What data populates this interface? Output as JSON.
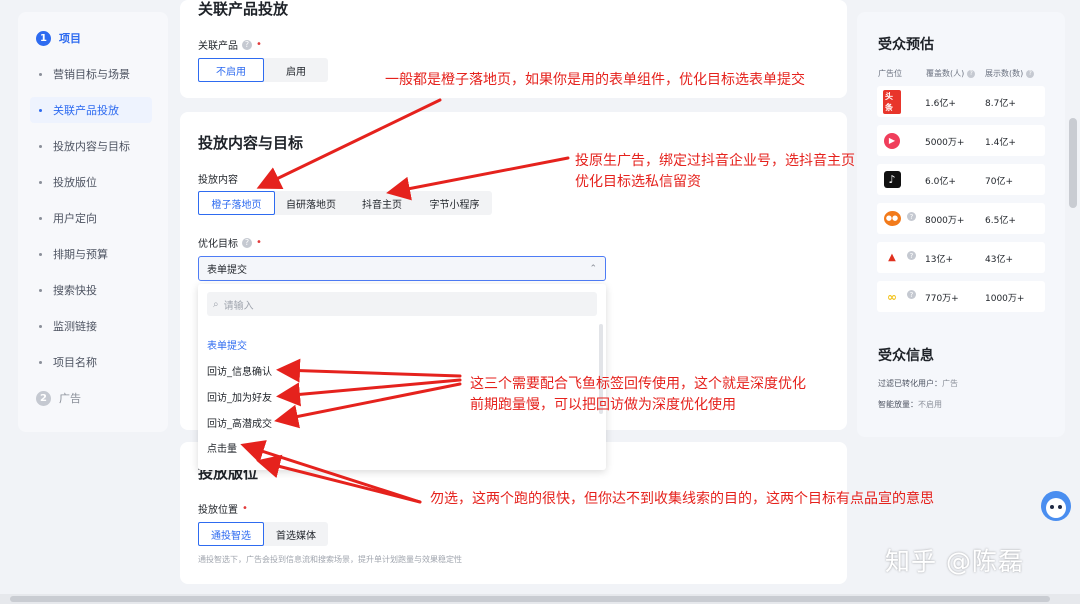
{
  "sidebar": {
    "section1": {
      "num": "1",
      "label": "项目"
    },
    "items": [
      {
        "label": "营销目标与场景"
      },
      {
        "label": "关联产品投放"
      },
      {
        "label": "投放内容与目标"
      },
      {
        "label": "投放版位"
      },
      {
        "label": "用户定向"
      },
      {
        "label": "排期与预算"
      },
      {
        "label": "搜索快投"
      },
      {
        "label": "监测链接"
      },
      {
        "label": "项目名称"
      }
    ],
    "selected_index": 1,
    "section2": {
      "num": "2",
      "label": "广告"
    }
  },
  "related_product": {
    "title": "关联产品投放",
    "field_label": "关联产品",
    "options": [
      "不启用",
      "启用"
    ],
    "selected": "不启用"
  },
  "delivery": {
    "title": "投放内容与目标",
    "content_label": "投放内容",
    "content_options": [
      "橙子落地页",
      "自研落地页",
      "抖音主页",
      "字节小程序"
    ],
    "content_selected": "橙子落地页",
    "goal_label": "优化目标",
    "goal_value": "表单提交",
    "search_placeholder": "请输入",
    "goal_options": [
      "表单提交",
      "回访_信息确认",
      "回访_加为好友",
      "回访_高潜成交",
      "点击量"
    ],
    "goal_selected": "表单提交"
  },
  "placement": {
    "title": "投放版位",
    "field_label": "投放位置",
    "options": [
      "通投智选",
      "首选媒体"
    ],
    "selected": "通投智选",
    "hint": "通投智选下，广告会投到信息流和搜索场景，提升单计划跑量与效果稳定性"
  },
  "audience": {
    "title": "受众预估",
    "headers": [
      "广告位",
      "覆盖数(人)",
      "展示数(数)"
    ],
    "rows": [
      {
        "logo": "toutiao-logo",
        "coverage": "1.6亿+",
        "impressions": "8.7亿+"
      },
      {
        "logo": "xigua-logo",
        "coverage": "5000万+",
        "impressions": "1.4亿+"
      },
      {
        "logo": "douyin-logo",
        "coverage": "6.0亿+",
        "impressions": "70亿+"
      },
      {
        "logo": "huoshan-logo",
        "coverage": "8000万+",
        "impressions": "6.5亿+"
      },
      {
        "logo": "tomato-novel-logo",
        "coverage": "13亿+",
        "impressions": "43亿+"
      },
      {
        "logo": "pangle-logo",
        "coverage": "770万+",
        "impressions": "1000万+"
      }
    ],
    "info_title": "受众信息",
    "info": [
      {
        "label": "过滤已转化用户：",
        "value": "广告"
      },
      {
        "label": "智能放量：",
        "value": "不启用"
      }
    ]
  },
  "annotations": {
    "a1": "一般都是橙子落地页，如果你是用的表单组件，优化目标选表单提交",
    "a2_line1": "投原生广告，绑定过抖音企业号，选抖音主页",
    "a2_line2": "优化目标选私信留资",
    "a3_line1": "这三个需要配合飞鱼标签回传使用，这个就是深度优化",
    "a3_line2": "前期跑量慢，可以把回访做为深度优化使用",
    "a4": "勿选，这两个跑的很快，但你达不到收集线索的目的，这两个目标有点品宣的意思",
    "color": "#e5221d"
  },
  "watermark": "知乎 @陈磊"
}
